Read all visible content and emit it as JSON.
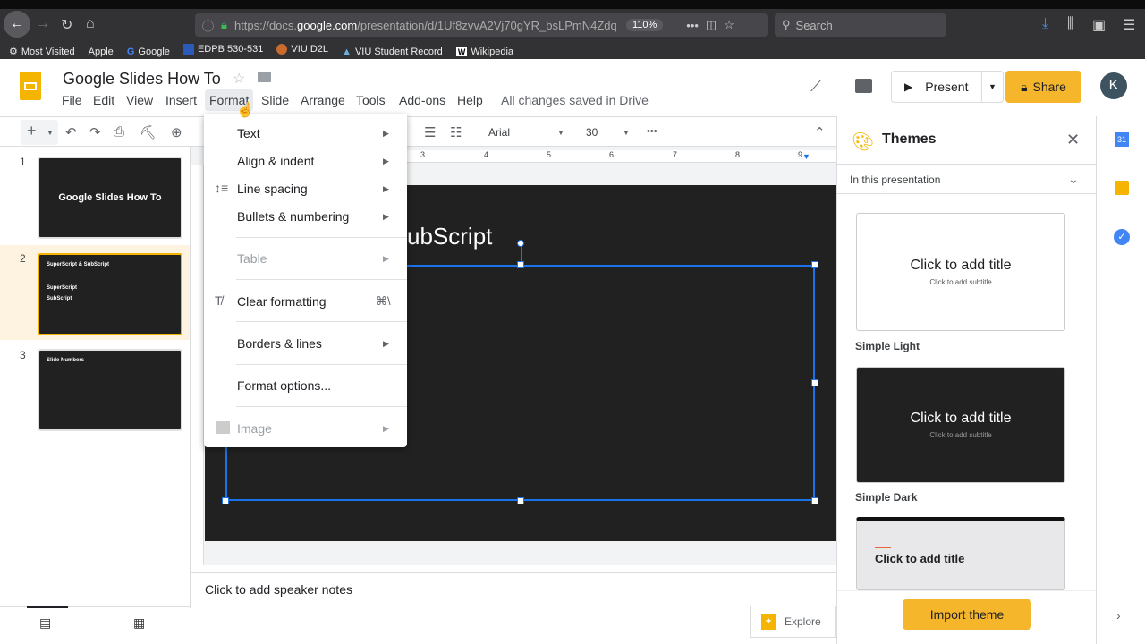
{
  "browser": {
    "url_domain": "https://docs.google.com",
    "url_host_bold": "google.com",
    "url_prefix": "https://docs.",
    "url_path": "/presentation/d/1Uf8zvvA2Vj70gYR_bsLPmN4Zdq",
    "zoom": "110%",
    "search_placeholder": "Search",
    "bookmarks": [
      "Most Visited",
      "Apple",
      "Google",
      "EDPB 530-531",
      "VIU D2L",
      "VIU Student Record",
      "Wikipedia"
    ]
  },
  "doc": {
    "title": "Google Slides How To",
    "saved_status": "All changes saved in Drive"
  },
  "menu": [
    "File",
    "Edit",
    "View",
    "Insert",
    "Format",
    "Slide",
    "Arrange",
    "Tools",
    "Add-ons",
    "Help"
  ],
  "header": {
    "present": "Present",
    "share": "Share",
    "avatar": "K"
  },
  "toolbar": {
    "font": "Arial",
    "size": "30",
    "more": "•••"
  },
  "ruler": [
    "3",
    "4",
    "5",
    "6",
    "7",
    "8",
    "9"
  ],
  "slides": [
    {
      "num": "1",
      "title": "Google Slides How To"
    },
    {
      "num": "2",
      "title": "SuperScript & SubScript",
      "lines": [
        "SuperScript",
        "SubScript"
      ]
    },
    {
      "num": "3",
      "title": "Slide Numbers"
    }
  ],
  "slide_visible_title": "ubScript",
  "format_menu": {
    "items": [
      {
        "label": "Text",
        "submenu": true
      },
      {
        "label": "Align & indent",
        "submenu": true
      },
      {
        "label": "Line spacing",
        "submenu": true
      },
      {
        "label": "Bullets & numbering",
        "submenu": true
      },
      {
        "label": "Table",
        "submenu": true,
        "disabled": true
      },
      {
        "label": "Clear formatting",
        "shortcut": "⌘\\"
      },
      {
        "label": "Borders & lines",
        "submenu": true
      },
      {
        "label": "Format options..."
      },
      {
        "label": "Image",
        "submenu": true,
        "disabled": true
      }
    ]
  },
  "notes": {
    "placeholder": "Click to add speaker notes"
  },
  "explore": "Explore",
  "themes": {
    "title": "Themes",
    "section": "In this presentation",
    "cards": [
      {
        "name": "Simple Light",
        "title": "Click to add title",
        "subtitle": "Click to add subtitle"
      },
      {
        "name": "Simple Dark",
        "title": "Click to add title",
        "subtitle": "Click to add subtitle"
      },
      {
        "title": "Click to add title"
      }
    ],
    "import": "Import theme"
  },
  "sidebar_calendar": "31",
  "colors": {
    "accent": "#f4b400",
    "selection": "#1a73e8",
    "slide_bg": "#212121"
  }
}
